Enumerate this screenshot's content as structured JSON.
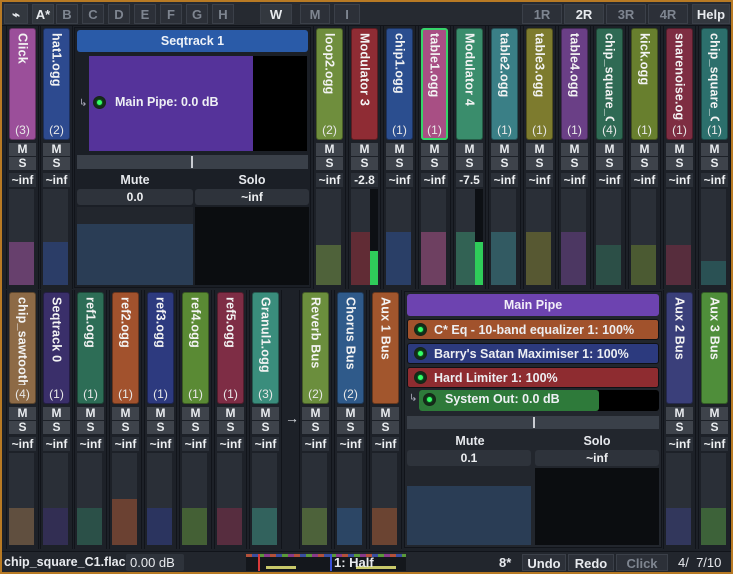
{
  "topbar": {
    "menu_icon": "wave-menu-icon",
    "tabs": [
      "A*",
      "B",
      "C",
      "D",
      "E",
      "F",
      "G",
      "H"
    ],
    "w_label": "W",
    "m_label": "M",
    "i_label": "I",
    "rows": [
      "1R",
      "2R",
      "3R",
      "4R"
    ],
    "help_label": "Help"
  },
  "top_strips": [
    {
      "name": "Click",
      "count": "(3)",
      "db": "~inf",
      "color": "#9b4f9a",
      "fader": 0.45,
      "meter": 0
    },
    {
      "name": "hat1.ogg",
      "count": "(2)",
      "db": "~inf",
      "color": "#2d4a8f",
      "fader": 0.45,
      "meter": 0
    },
    {
      "name": "loop2.ogg",
      "count": "(2)",
      "db": "~inf",
      "color": "#6f8e3d",
      "fader": 0.42,
      "meter": 0
    },
    {
      "name": "Modulator 3",
      "count": "",
      "db": "-2.8",
      "color": "#8f2c34",
      "fader": 0.55,
      "meter": 0.35
    },
    {
      "name": "chip1.ogg",
      "count": "(1)",
      "db": "~inf",
      "color": "#2b4e8f",
      "fader": 0.55,
      "meter": 0
    },
    {
      "name": "table1.ogg",
      "count": "(1)",
      "db": "~inf",
      "color": "#a84f84",
      "fader": 0.55,
      "meter": 0,
      "selected": true
    },
    {
      "name": "Modulator 4",
      "count": "",
      "db": "-7.5",
      "color": "#3a8d6c",
      "fader": 0.55,
      "meter": 0.45
    },
    {
      "name": "table2.ogg",
      "count": "(1)",
      "db": "~inf",
      "color": "#3a7f86",
      "fader": 0.55,
      "meter": 0
    },
    {
      "name": "table3.ogg",
      "count": "(1)",
      "db": "~inf",
      "color": "#7d7b2e",
      "fader": 0.55,
      "meter": 0
    },
    {
      "name": "table4.ogg",
      "count": "(1)",
      "db": "~inf",
      "color": "#6a3f86",
      "fader": 0.55,
      "meter": 0
    },
    {
      "name": "chip_square_C",
      "count": "(4)",
      "db": "~inf",
      "color": "#2f6a54",
      "fader": 0.42,
      "meter": 0
    },
    {
      "name": "kick.ogg",
      "count": "(1)",
      "db": "~inf",
      "color": "#687f2e",
      "fader": 0.42,
      "meter": 0
    },
    {
      "name": "snarenoise.ogg",
      "count": "(1)",
      "db": "~inf",
      "color": "#7e2d42",
      "fader": 0.42,
      "meter": 0
    },
    {
      "name": "chip_square_C",
      "count": "(1)",
      "db": "~inf",
      "color": "#2c6f6c",
      "fader": 0.25,
      "meter": 0
    }
  ],
  "seqtrack": {
    "title": "Seqtrack 1",
    "plugin": "Main Pipe: 0.0 dB",
    "mute_label": "Mute",
    "solo_label": "Solo",
    "mute_value": "0.0",
    "solo_value": "~inf"
  },
  "bottom_strips": [
    {
      "name": "chip_sawtooth",
      "count": "(4)",
      "db": "~inf",
      "color": "#8d6a46",
      "fader": 0.4
    },
    {
      "name": "Seqtrack 0",
      "count": "(1)",
      "db": "~inf",
      "color": "#3a2f6a",
      "fader": 0.4
    },
    {
      "name": "ref1.ogg",
      "count": "(1)",
      "db": "~inf",
      "color": "#2d6d56",
      "fader": 0.4
    },
    {
      "name": "ref2.ogg",
      "count": "(1)",
      "db": "~inf",
      "color": "#a2522d",
      "fader": 0.5
    },
    {
      "name": "ref3.ogg",
      "count": "(1)",
      "db": "~inf",
      "color": "#2d3a7f",
      "fader": 0.4
    },
    {
      "name": "ref4.ogg",
      "count": "(1)",
      "db": "~inf",
      "color": "#5a8a34",
      "fader": 0.4
    },
    {
      "name": "ref5.ogg",
      "count": "(1)",
      "db": "~inf",
      "color": "#7e2d45",
      "fader": 0.4
    },
    {
      "name": "Granul1.ogg",
      "count": "(3)",
      "db": "~inf",
      "color": "#3a8d7c",
      "fader": 0.4
    },
    {
      "name": "Reverb Bus",
      "count": "(2)",
      "db": "~inf",
      "color": "#6b8e3d",
      "fader": 0.4
    },
    {
      "name": "Chorus Bus",
      "count": "(2)",
      "db": "~inf",
      "color": "#2f5a8a",
      "fader": 0.4
    },
    {
      "name": "Aux 1 Bus",
      "count": "",
      "db": "~inf",
      "color": "#a2562d",
      "fader": 0.4
    },
    {
      "name": "Aux 2 Bus",
      "count": "",
      "db": "~inf",
      "color": "#3a3f7a",
      "fader": 0.4
    },
    {
      "name": "Aux 3 Bus",
      "count": "",
      "db": "~inf",
      "color": "#4f8e3a",
      "fader": 0.4
    }
  ],
  "arrow": "→",
  "main_pipe": {
    "title": "Main Pipe",
    "plugins": [
      {
        "label": "C* Eq - 10-band equalizer 1: 100%",
        "color": "#a1522c"
      },
      {
        "label": "Barry's Satan Maximiser 1: 100%",
        "color": "#2c3a7e"
      },
      {
        "label": "Hard Limiter 1: 100%",
        "color": "#8e2c30"
      }
    ],
    "output": "System Out: 0.0 dB",
    "mute_label": "Mute",
    "solo_label": "Solo",
    "mute_value": "0.1",
    "solo_value": "~inf"
  },
  "mute_short": "M",
  "solo_short": "S",
  "bottombar": {
    "filename": "chip_square_C1.flac:",
    "gain": "0.00 dB",
    "quant": "1: Half",
    "octave": "8*",
    "undo": "Undo",
    "redo": "Redo",
    "click": "Click",
    "position": "4/  7/10"
  }
}
